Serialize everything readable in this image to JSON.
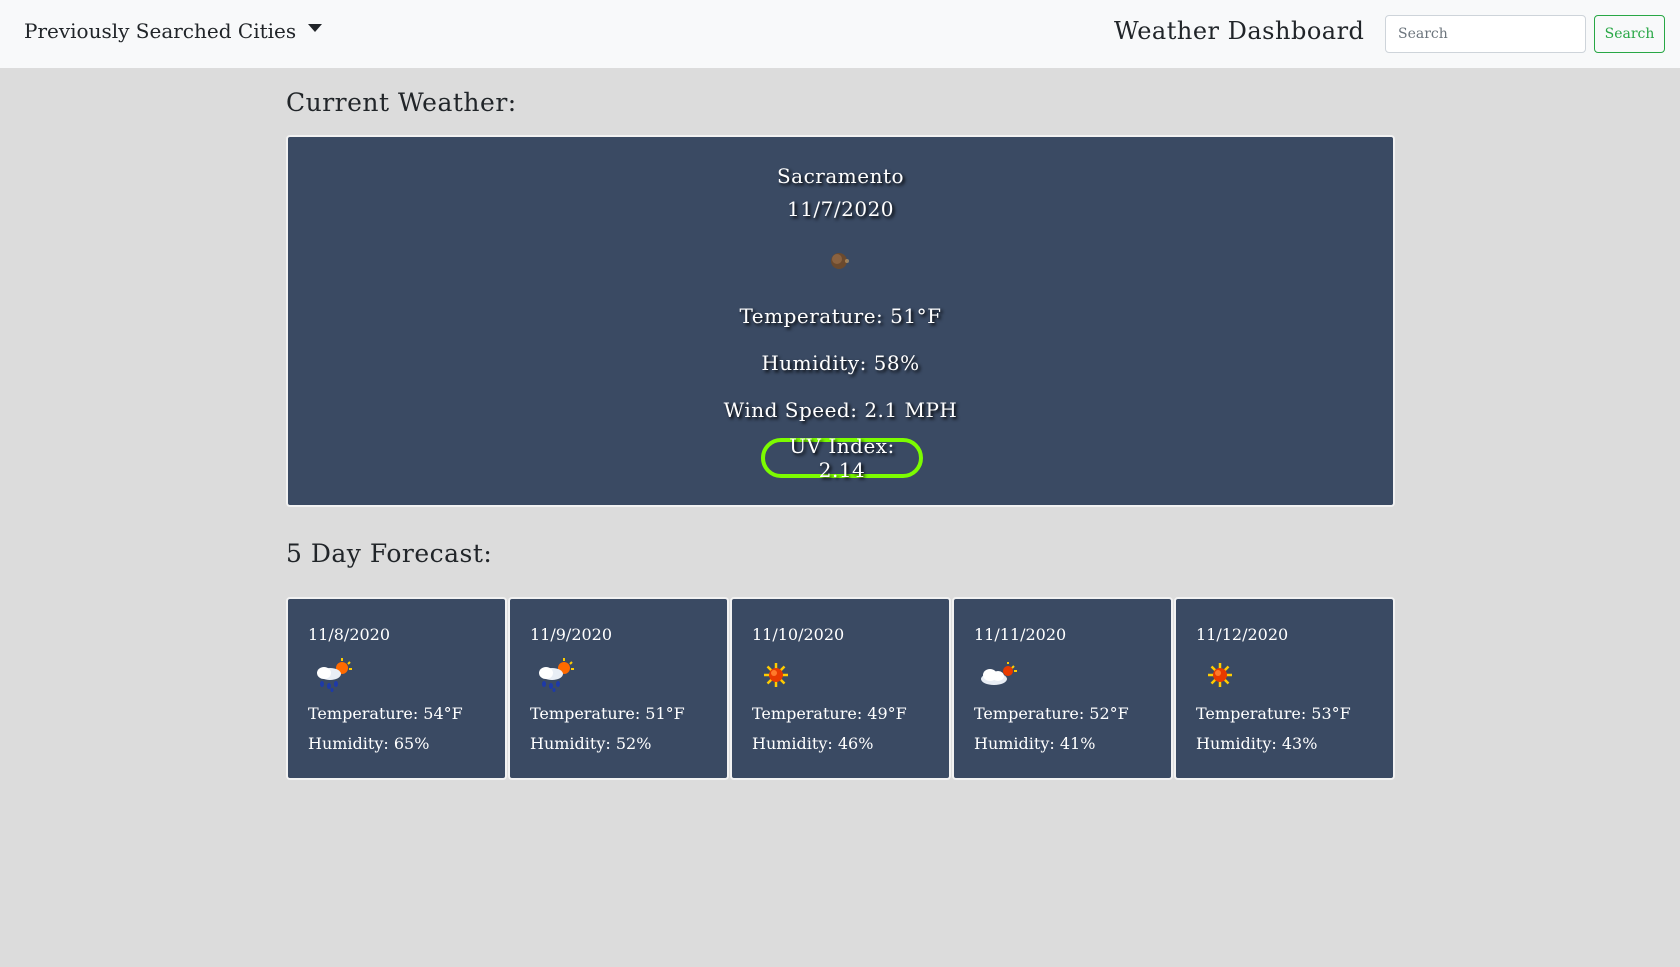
{
  "navbar": {
    "dropdown_label": "Previously Searched Cities",
    "brand": "Weather Dashboard",
    "search_placeholder": "Search",
    "search_button": "Search"
  },
  "current": {
    "section_title": "Current Weather:",
    "city": "Sacramento",
    "date": "11/7/2020",
    "icon": "moon-night-icon",
    "temperature": "Temperature: 51°F",
    "humidity": "Humidity: 58%",
    "wind": "Wind Speed: 2.1 MPH",
    "uv": "UV Index: 2.14",
    "uv_color": "#7cfc00"
  },
  "forecast": {
    "section_title": "5 Day Forecast:",
    "days": [
      {
        "date": "11/8/2020",
        "icon": "rain-sun-icon",
        "temp": "Temperature: 54°F",
        "humidity": "Humidity: 65%"
      },
      {
        "date": "11/9/2020",
        "icon": "rain-sun-icon",
        "temp": "Temperature: 51°F",
        "humidity": "Humidity: 52%"
      },
      {
        "date": "11/10/2020",
        "icon": "sun-icon",
        "temp": "Temperature: 49°F",
        "humidity": "Humidity: 46%"
      },
      {
        "date": "11/11/2020",
        "icon": "cloud-sun-icon",
        "temp": "Temperature: 52°F",
        "humidity": "Humidity: 41%"
      },
      {
        "date": "11/12/2020",
        "icon": "sun-icon",
        "temp": "Temperature: 53°F",
        "humidity": "Humidity: 43%"
      }
    ]
  }
}
